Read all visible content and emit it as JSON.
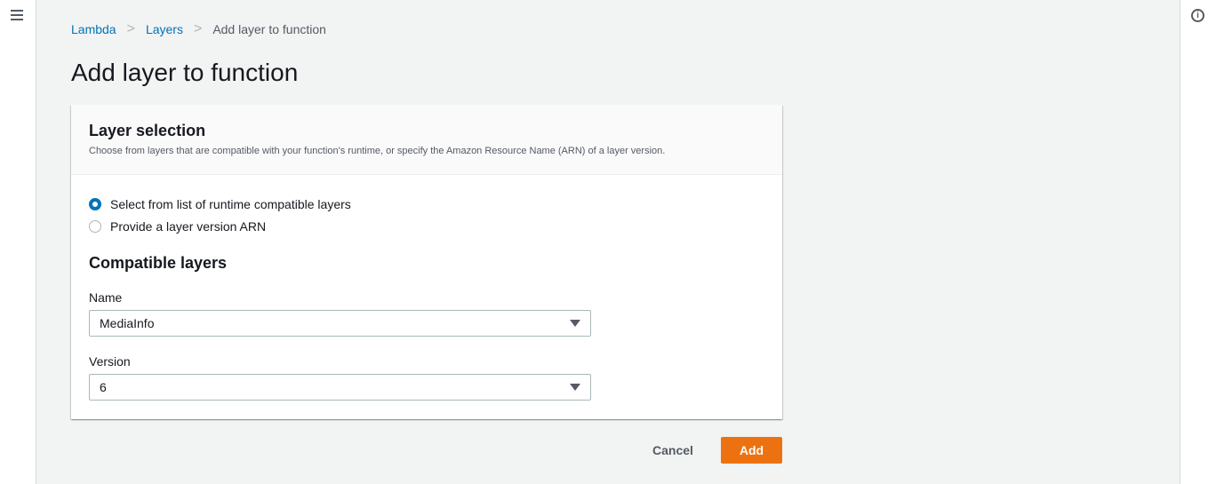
{
  "breadcrumb": {
    "items": [
      "Lambda",
      "Layers"
    ],
    "current": "Add layer to function",
    "sep": ">"
  },
  "page_title": "Add layer to function",
  "card": {
    "title": "Layer selection",
    "description": "Choose from layers that are compatible with your function's runtime, or specify the Amazon Resource Name (ARN) of a layer version.",
    "radios": [
      {
        "label": "Select from list of runtime compatible layers",
        "selected": true
      },
      {
        "label": "Provide a layer version ARN",
        "selected": false
      }
    ],
    "section_title": "Compatible layers",
    "name_label": "Name",
    "name_value": "MediaInfo",
    "version_label": "Version",
    "version_value": "6"
  },
  "actions": {
    "cancel": "Cancel",
    "add": "Add"
  },
  "icons": {
    "info": "i"
  },
  "colors": {
    "link": "#0073bb",
    "primary": "#ec7211"
  }
}
